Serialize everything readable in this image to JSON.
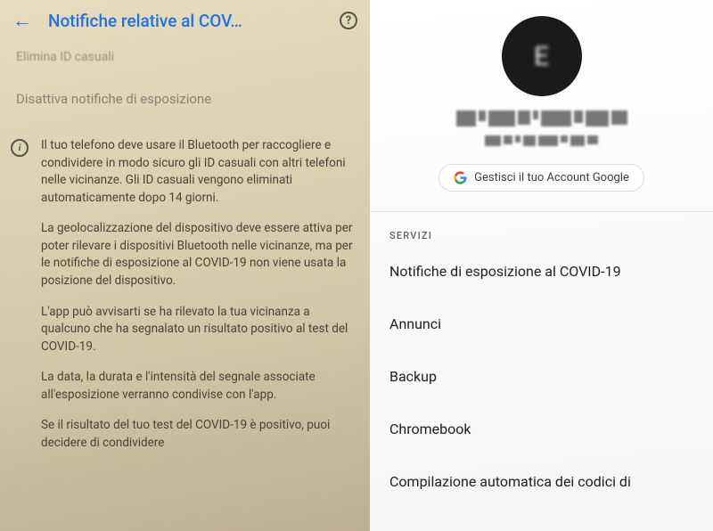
{
  "left": {
    "title": "Notifiche relative al COV…",
    "fadedItem": "Elimina ID casuali",
    "disableItem": "Disattiva notifiche di esposizione",
    "paragraphs": [
      "Il tuo telefono deve usare il Bluetooth per raccogliere e condividere in modo sicuro gli ID casuali con altri telefoni nelle vicinanze. Gli ID casuali vengono eliminati automaticamente dopo 14 giorni.",
      "La geolocalizzazione del dispositivo deve essere attiva per poter rilevare i dispositivi Bluetooth nelle vicinanze, ma per le notifiche di esposizione al COVID-19 non viene usata la posizione del dispositivo.",
      "L'app può avvisarti se ha rilevato la tua vicinanza a qualcuno che ha segnalato un risultato positivo al test del COVID-19.",
      "La data, la durata e l'intensità del segnale associate all'esposizione verranno condivise con l'app.",
      "Se il risultato del tuo test del COVID-19 è positivo, puoi decidere di condividere"
    ]
  },
  "right": {
    "avatarLetter": "E",
    "manageLabel": "Gestisci il tuo Account Google",
    "sectionLabel": "SERVIZI",
    "items": [
      "Notifiche di esposizione al COVID-19",
      "Annunci",
      "Backup",
      "Chromebook",
      "Compilazione automatica dei codici di"
    ]
  }
}
